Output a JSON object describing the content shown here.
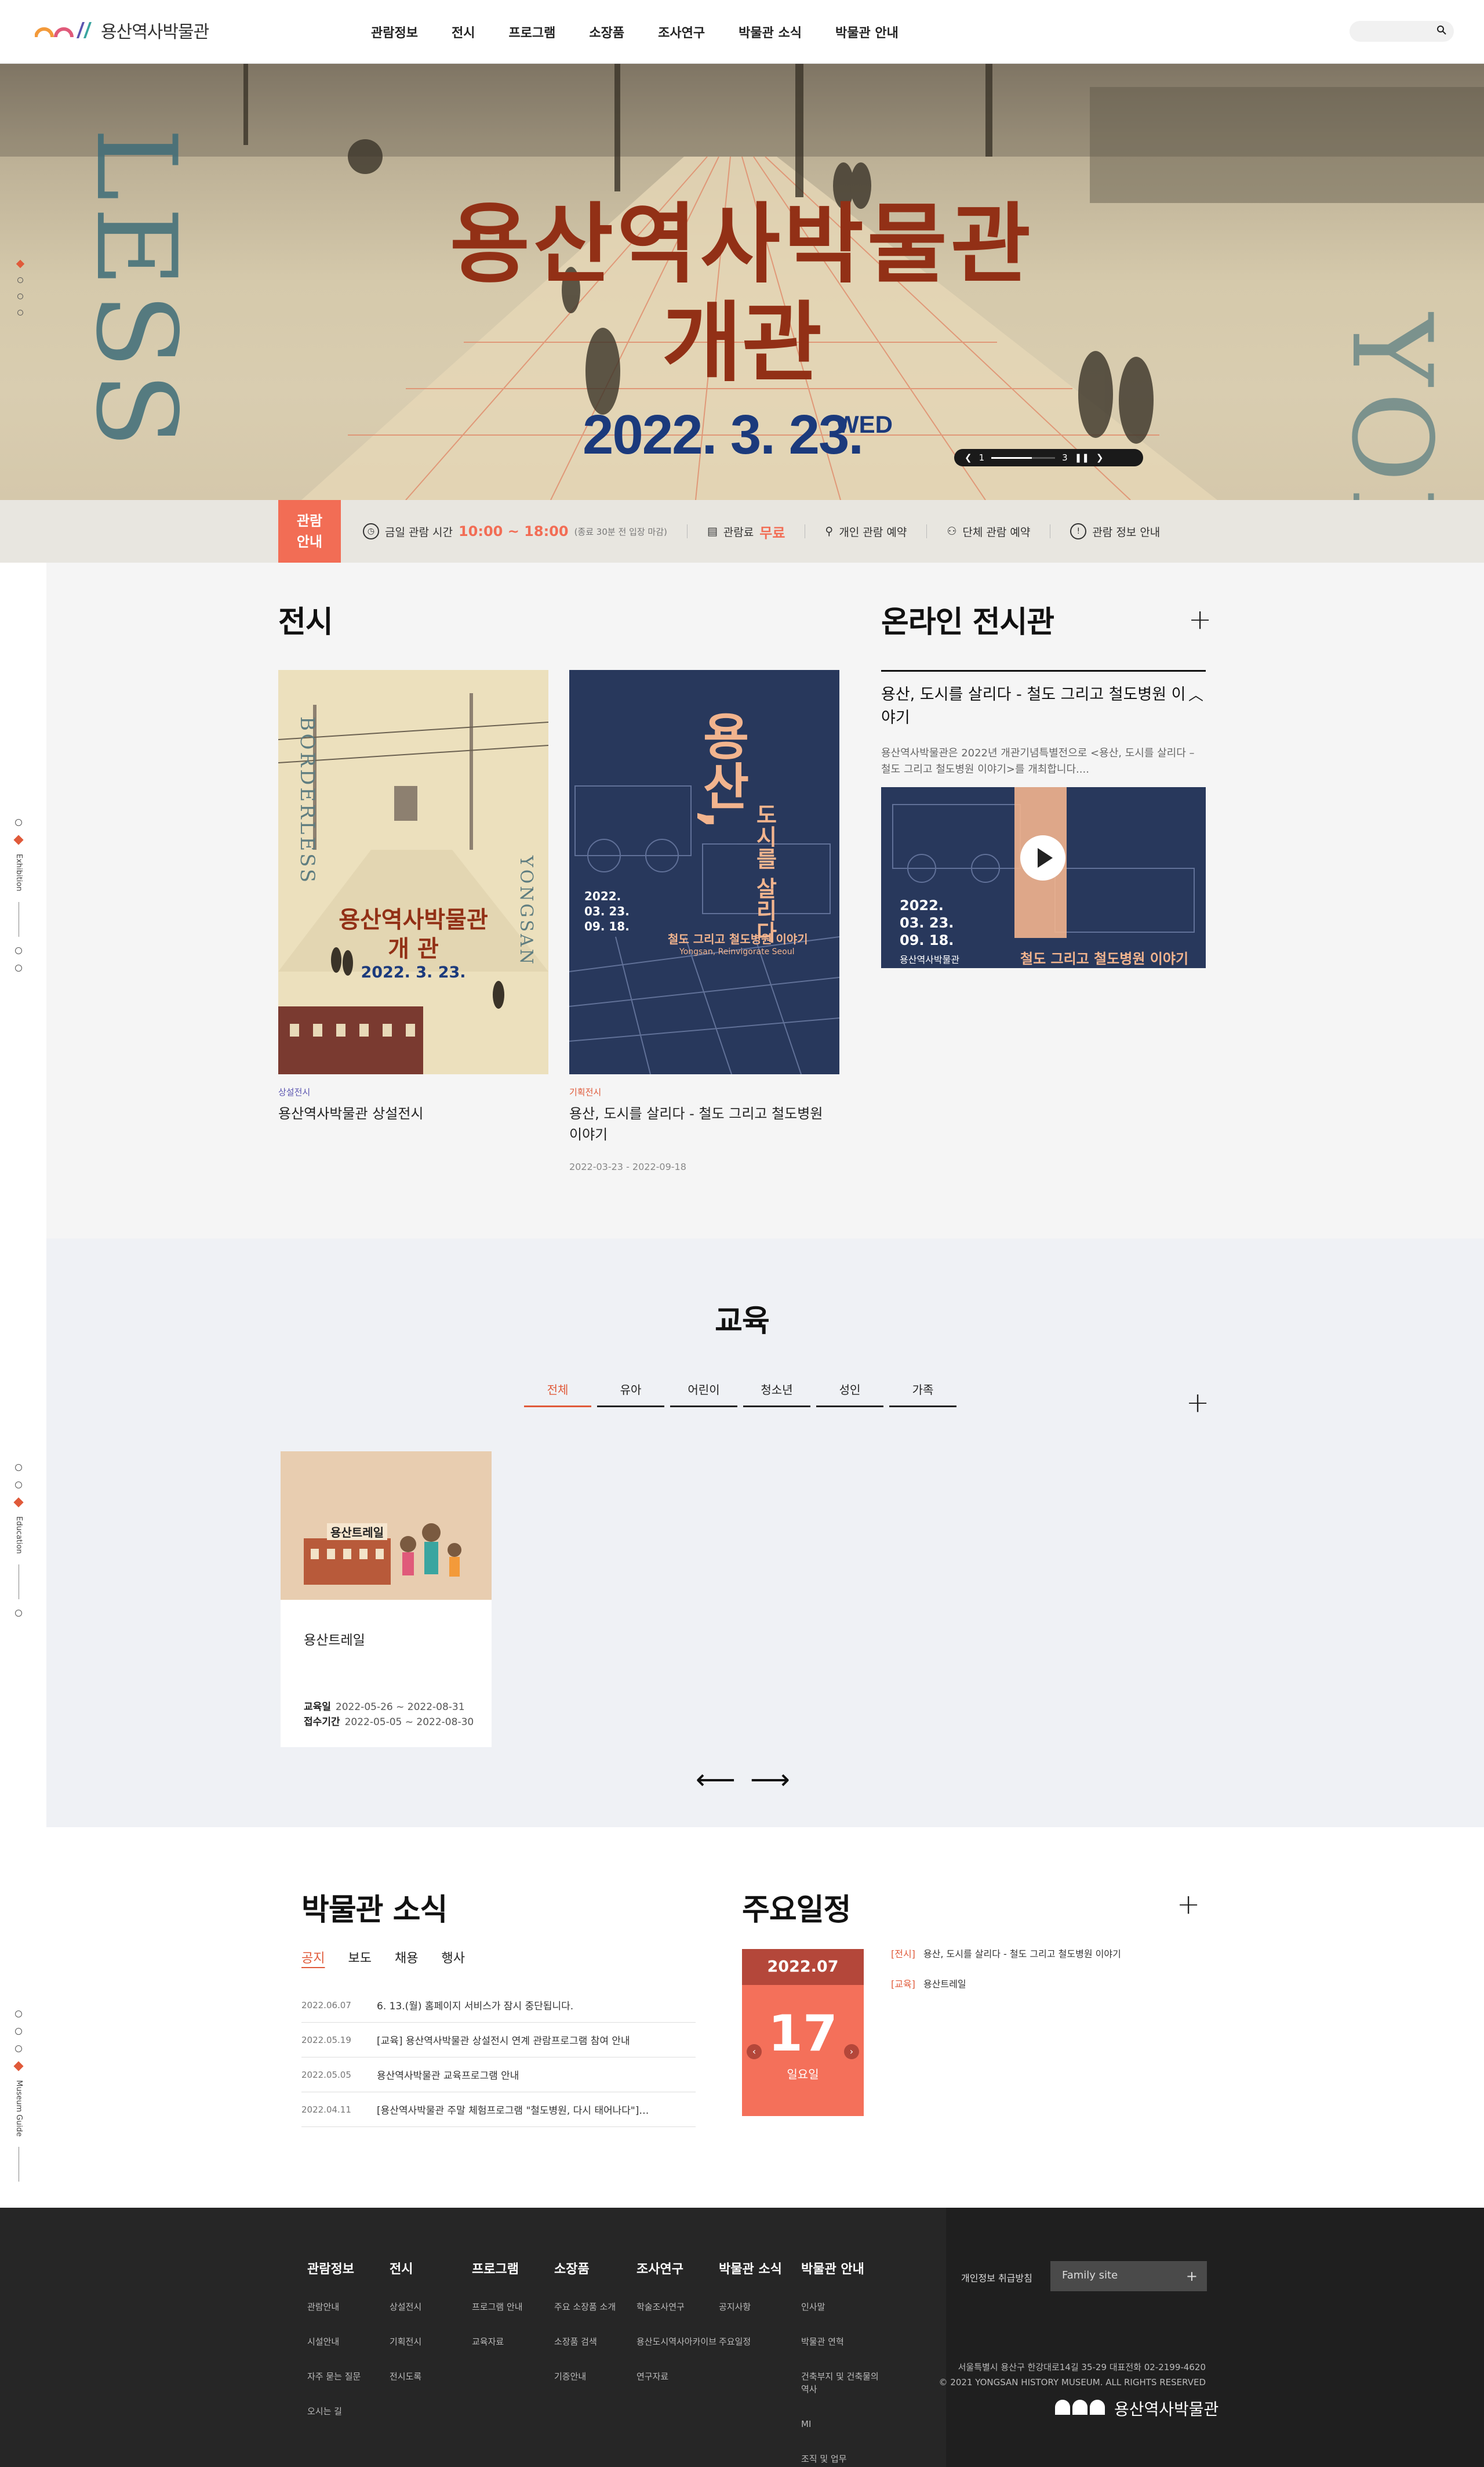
{
  "header": {
    "logo_text": "용산역사박물관",
    "nav": [
      "관람정보",
      "전시",
      "프로그램",
      "소장품",
      "조사연구",
      "박물관 소식",
      "박물관 안내"
    ],
    "search_icon": "search-icon"
  },
  "hero": {
    "title_line1": "용산역사박물관",
    "title_line2": "개관",
    "date": "2022. 3. 23.",
    "weekday": "WED",
    "side_left": "LESS",
    "side_right": "YON",
    "slider": {
      "current": "1",
      "total": "3",
      "pause_icon": "pause-icon"
    }
  },
  "info": {
    "tag": "관람\n안내",
    "hours_label": "금일 관람 시간",
    "hours": "10:00 ~ 18:00",
    "hours_note": "(종료 30분 전 입장 마감)",
    "fee_label": "관람료",
    "fee": "무료",
    "personal": "개인 관람 예약",
    "group": "단체 관람 예약",
    "guide": "관람 정보 안내"
  },
  "side_nav": {
    "exhibition_label": "Exhibition",
    "education_label": "Education",
    "guide_label": "Museum Guide"
  },
  "exhibition": {
    "title": "전시",
    "items": [
      {
        "category": "상설전시",
        "title": "용산역사박물관 상설전시",
        "date": "",
        "poster": {
          "title_line1": "용산역사박물관",
          "title_line2": "개 관",
          "date": "2022. 3. 23.",
          "side": "YONGSAN",
          "top": "BORDERLESS"
        }
      },
      {
        "category": "기획전시",
        "title": "용산, 도시를 살리다 - 철도 그리고 철도병원 이야기",
        "date": "2022-03-23 - 2022-09-18",
        "poster": {
          "big": "용산,",
          "sub": "도시를 살리다",
          "date1": "2022.",
          "date2": "03. 23.",
          "date3": "09. 18.",
          "caption": "철도 그리고 철도병원 이야기",
          "eng": "Yongsan, Reinvigorate Seoul"
        }
      }
    ]
  },
  "online": {
    "title": "온라인 전시관",
    "subtitle": "용산, 도시를 살리다 - 철도 그리고 철도병원 이야기",
    "desc": "용산역사박물관은 2022년 개관기념특별전으로 <용산, 도시를 살리다 – 철도 그리고 철도병원 이야기>를 개최합니다....",
    "video": {
      "date1": "2022.",
      "date2": "03. 23.",
      "date3": "09. 18.",
      "org": "용산역사박물관",
      "caption": "철도 그리고 철도병원 이야기"
    }
  },
  "education": {
    "title": "교육",
    "tabs": [
      "전체",
      "유아",
      "어린이",
      "청소년",
      "성인",
      "가족"
    ],
    "card": {
      "title": "용산트레일",
      "period_label": "교육일",
      "period": "2022-05-26 ~ 2022-08-31",
      "apply_label": "접수기간",
      "apply": "2022-05-05 ~ 2022-08-30",
      "image_caption": "용산트레일"
    }
  },
  "news": {
    "title": "박물관 소식",
    "tabs": [
      "공지",
      "보도",
      "채용",
      "행사"
    ],
    "items": [
      {
        "date": "2022.06.07",
        "text": "6. 13.(월) 홈페이지 서비스가 잠시 중단됩니다."
      },
      {
        "date": "2022.05.19",
        "text": "[교육] 용산역사박물관 상설전시 연계 관람프로그램 참여 안내"
      },
      {
        "date": "2022.05.05",
        "text": "용산역사박물관 교육프로그램 안내"
      },
      {
        "date": "2022.04.11",
        "text": "[용산역사박물관 주말 체험프로그램 \"철도병원, 다시 태어나다\"]…"
      }
    ]
  },
  "schedule": {
    "title": "주요일정",
    "month": "2022.07",
    "day": "17",
    "weekday": "일요일",
    "items": [
      {
        "tag": "[전시]",
        "text": "용산, 도시를 살리다 - 철도 그리고 철도병원 이야기"
      },
      {
        "tag": "[교육]",
        "text": "용산트레일"
      }
    ]
  },
  "footer": {
    "columns": [
      {
        "title": "관람정보",
        "links": [
          "관람안내",
          "시설안내",
          "자주 묻는 질문",
          "오시는 길"
        ]
      },
      {
        "title": "전시",
        "links": [
          "상설전시",
          "기획전시",
          "전시도록"
        ]
      },
      {
        "title": "프로그램",
        "links": [
          "프로그램 안내",
          "교육자료"
        ]
      },
      {
        "title": "소장품",
        "links": [
          "주요 소장품 소개",
          "소장품 검색",
          "기증안내"
        ]
      },
      {
        "title": "조사연구",
        "links": [
          "학술조사연구",
          "용산도시역사아카이브",
          "연구자료"
        ]
      },
      {
        "title": "박물관 소식",
        "links": [
          "공지사항",
          "주요일정"
        ]
      },
      {
        "title": "박물관 안내",
        "links": [
          "인사말",
          "박물관 연혁",
          "건축부지 및 건축물의 역사",
          "MI",
          "조직 및 업무"
        ]
      }
    ],
    "privacy": "개인정보 취급방침",
    "family_site": "Family site",
    "address": "서울특별시 용산구 한강대로14길 35-29 대표전화 02-2199-4620",
    "copyright": "© 2021 YONGSAN HISTORY MUSEUM. ALL RIGHTS RESERVED",
    "logo_text": "용산역사박물관"
  },
  "colors": {
    "accent": "#f26d55",
    "hero_title": "#923016",
    "hero_date": "#1b3a7c",
    "navy": "#28385c"
  }
}
